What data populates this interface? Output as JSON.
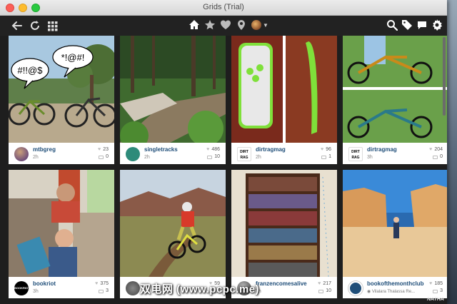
{
  "window": {
    "title": "Grids (Trial)"
  },
  "toolbar": {
    "left_icons": [
      "back-icon",
      "refresh-icon",
      "grid-view-icon"
    ],
    "center_icons": [
      "home-icon",
      "star-icon",
      "heart-icon",
      "location-icon"
    ],
    "right_icons": [
      "search-icon",
      "tag-icon",
      "messages-icon",
      "settings-icon"
    ]
  },
  "posts": [
    {
      "user": "mtbgreg",
      "time": "2h",
      "likes": "23",
      "comments": "0",
      "speech_left": "#!!@$",
      "speech_right": "*!@#!"
    },
    {
      "user": "singletracks",
      "time": "2h",
      "likes": "486",
      "comments": "10"
    },
    {
      "user": "dirtragmag",
      "time": "2h",
      "likes": "96",
      "comments": "1",
      "logo_text": "DIRT RAG"
    },
    {
      "user": "dirtragmag",
      "time": "3h",
      "likes": "204",
      "comments": "0",
      "logo_text": "DIRT RAG"
    },
    {
      "user": "bookriot",
      "time": "3h",
      "likes": "375",
      "comments": "3",
      "logo_text": "BOOKRIOT"
    },
    {
      "user": "",
      "time": "",
      "likes": "59",
      "comments": ""
    },
    {
      "user": "franzencomesalive",
      "time": "3h",
      "likes": "217",
      "comments": "10"
    },
    {
      "user": "bookofthemonthclub",
      "location": "Vilalara Thalassa Re...",
      "likes": "185",
      "comments": "3"
    }
  ],
  "colors": {
    "username": "#1f4e79",
    "toolbar_bg": "#222222",
    "grid_bg": "#1e1e1e"
  },
  "watermark": {
    "text": "双电网 (www.pcpc.me)",
    "corner_text": "NATHA"
  }
}
